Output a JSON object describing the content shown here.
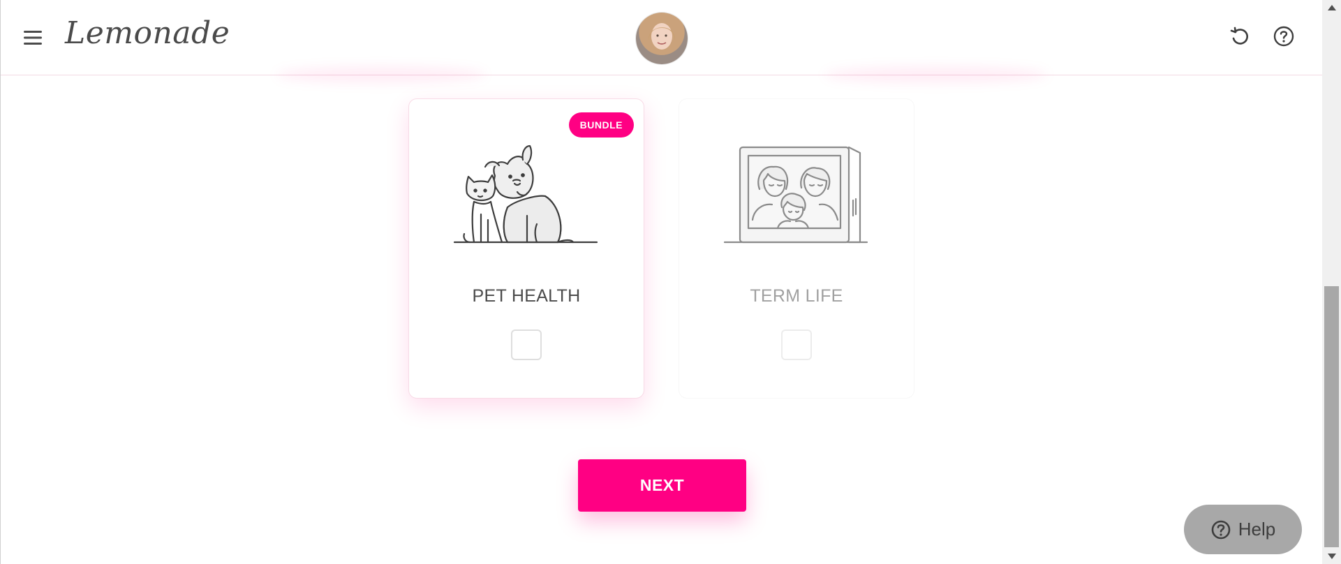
{
  "header": {
    "logo": "Lemonade",
    "menu_icon": "hamburger-menu-icon",
    "avatar_alt": "assistant-avatar",
    "undo_icon": "undo-icon",
    "help_icon": "question-circle-icon"
  },
  "products": [
    {
      "title": "PET HEALTH",
      "badge": "BUNDLE",
      "illustration": "pets-icon",
      "selected": true,
      "checked": false
    },
    {
      "title": "TERM LIFE",
      "illustration": "family-portrait-icon",
      "selected": false,
      "checked": false
    }
  ],
  "actions": {
    "next_label": "NEXT"
  },
  "help_widget": {
    "label": "Help",
    "icon": "question-circle-icon"
  },
  "colors": {
    "brand": "#ff0083",
    "text": "#4a4a4a",
    "muted": "#a0a0a0",
    "help_bg": "#a8a8a8"
  }
}
